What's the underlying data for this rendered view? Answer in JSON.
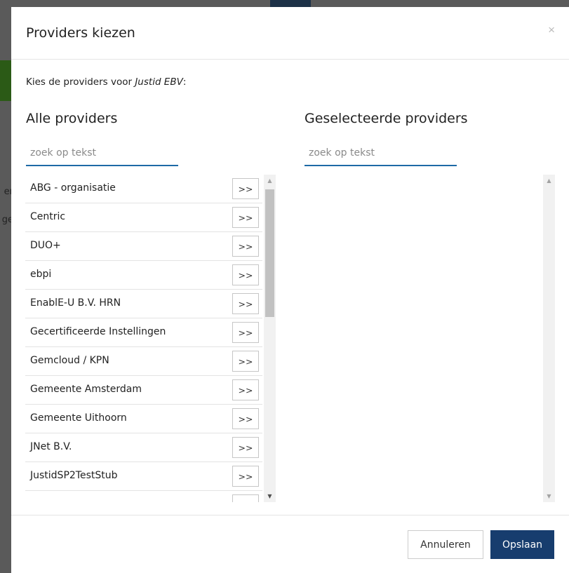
{
  "background": {
    "fragment_1": "er",
    "fragment_2": "ge"
  },
  "modal": {
    "title": "Providers kiezen",
    "close_symbol": "×",
    "intro_prefix": "Kies de providers voor ",
    "intro_entity": "Justid EBV",
    "intro_suffix": ":",
    "all_providers": {
      "title": "Alle providers",
      "search_placeholder": "zoek op tekst",
      "add_label": ">>",
      "items": [
        "ABG - organisatie",
        "Centric",
        "DUO+",
        "ebpi",
        "EnablE-U B.V. HRN",
        "Gecertificeerde Instellingen",
        "Gemcloud / KPN",
        "Gemeente Amsterdam",
        "Gemeente Uithoorn",
        "JNet B.V.",
        "JustidSP2TestStub",
        ""
      ]
    },
    "selected_providers": {
      "title": "Geselecteerde providers",
      "search_placeholder": "zoek op tekst",
      "items": []
    },
    "footer": {
      "cancel_label": "Annuleren",
      "save_label": "Opslaan"
    }
  },
  "colors": {
    "accent_blue": "#1e6aa6",
    "primary_button": "#173d6e",
    "overlay": "#5a5a5a"
  },
  "icons": {
    "scroll_up": "triangle-up-icon",
    "scroll_down": "triangle-down-icon"
  }
}
